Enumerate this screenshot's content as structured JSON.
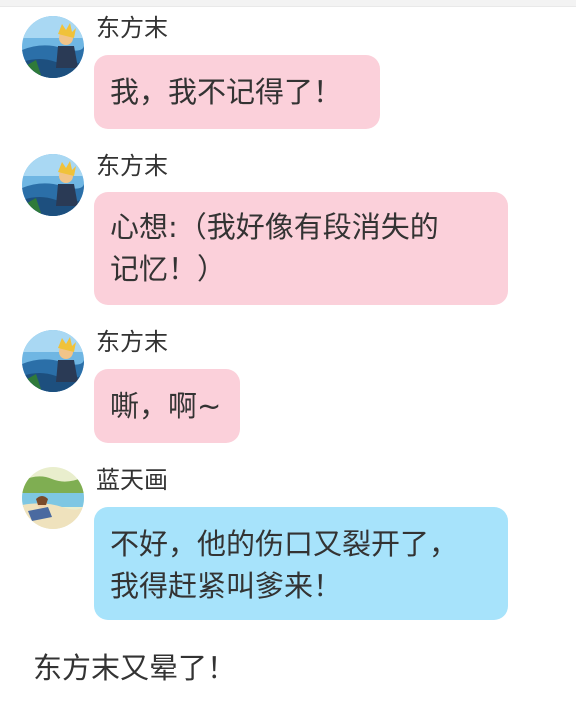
{
  "messages": [
    {
      "sender": "东方末",
      "lines": [
        "我，我不记得了！"
      ],
      "bubble_color": "#fbd0da"
    },
    {
      "sender": "东方末",
      "lines": [
        "心想:（我好像有段消失的",
        "记忆！）"
      ],
      "bubble_color": "#fbd0da"
    },
    {
      "sender": "东方末",
      "lines": [
        "嘶，啊~"
      ],
      "bubble_color": "#fbd0da"
    },
    {
      "sender": "蓝天画",
      "lines": [
        "不好，他的伤口又裂开了，",
        "我得赶紧叫爹来！"
      ],
      "bubble_color": "#a7e3fb"
    }
  ],
  "narration": "东方末又晕了！",
  "colors": {
    "pink_bubble": "#fbd0da",
    "blue_bubble": "#a7e3fb",
    "text": "#333333"
  },
  "icons": {
    "avatar_dongfangmo": "avatar-sea-boy-icon",
    "avatar_lantianhua": "avatar-beach-girl-icon"
  }
}
